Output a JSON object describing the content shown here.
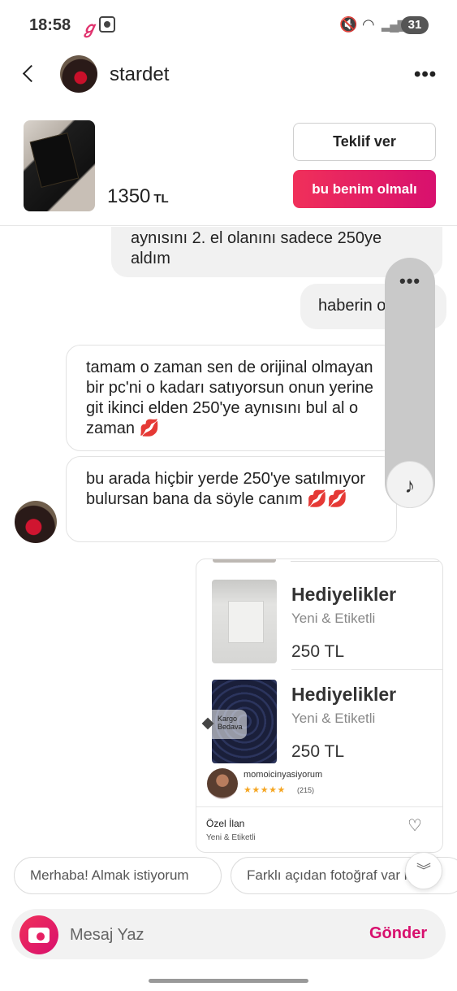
{
  "status_bar": {
    "time": "18:58",
    "app_glyph": "ℊ",
    "battery": "31"
  },
  "header": {
    "username": "stardet"
  },
  "product": {
    "price": "1350",
    "currency": "TL",
    "offer_label": "Teklif ver",
    "buy_label": "bu benim olmalı"
  },
  "messages": [
    {
      "from": "me",
      "text": "aynısını 2. el olanını sadece 250ye aldım"
    },
    {
      "from": "me",
      "text": "haberin olsun"
    },
    {
      "from": "them",
      "text": "tamam o zaman sen de orijinal olmayan bir pc'ni o kadarı satıyorsun onun yerine git ikinci elden 250'ye aynısını bul al o zaman 💋"
    },
    {
      "from": "them",
      "text": "bu arada hiçbir yerde 250'ye satılmıyor bulursan bana da söyle canım 💋💋"
    }
  ],
  "shared_listing": {
    "items": [
      {
        "title": "Hediyelikler",
        "condition": "Yeni & Etiketli",
        "price": "250 TL"
      },
      {
        "title": "Hediyelikler",
        "condition": "Yeni & Etiketli",
        "price": "250 TL"
      }
    ],
    "cargo_badge_line1": "Kargo",
    "cargo_badge_line2": "Bedava",
    "seller_name": "momoicinyasiyorum",
    "seller_stars": "★★★★★",
    "seller_rating_count": "(215)",
    "special_label": "Özel İlan",
    "special_condition": "Yeni & Etiketli"
  },
  "quick_replies": [
    "Merhaba! Almak istiyorum",
    "Farklı açıdan fotoğraf var mı?"
  ],
  "composer": {
    "placeholder": "Mesaj Yaz",
    "send_label": "Gönder"
  },
  "accent_color": "#d8106e"
}
